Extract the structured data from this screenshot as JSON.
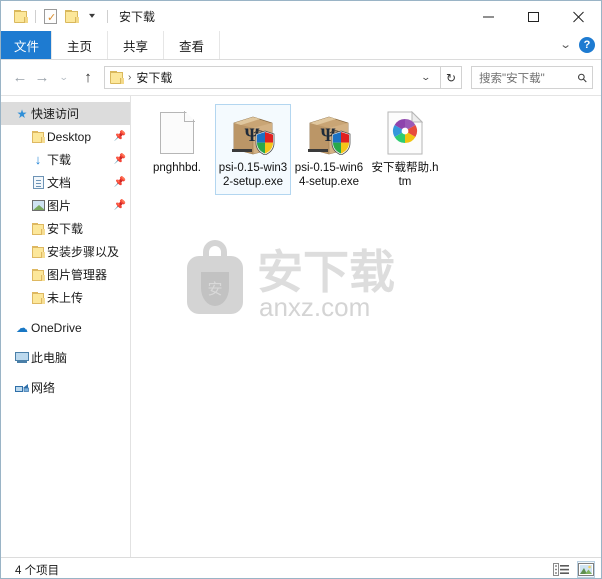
{
  "window": {
    "title": "安下载",
    "quick_access": [
      {
        "name": "folder-icon",
        "label": "文件夹"
      },
      {
        "name": "properties-icon",
        "label": "属性"
      },
      {
        "name": "new-folder-icon",
        "label": "新建文件夹"
      },
      {
        "name": "customize-dropdown-icon",
        "label": "自定义快速访问工具栏"
      }
    ],
    "controls": {
      "minimize": "最小化",
      "maximize": "最大化",
      "close": "关闭"
    }
  },
  "ribbon": {
    "tabs": [
      {
        "label": "文件",
        "selected": true
      },
      {
        "label": "主页",
        "selected": false
      },
      {
        "label": "共享",
        "selected": false
      },
      {
        "label": "查看",
        "selected": false
      }
    ],
    "collapse_label": "展开功能区",
    "help_label": "?",
    "accent_color": "#1e7bd1"
  },
  "address": {
    "back_label": "后退",
    "forward_label": "前进",
    "recent_label": "最近浏览的位置",
    "up_label": "上移一级",
    "breadcrumb": [
      "安下载"
    ],
    "breadcrumb_separator": "›",
    "dropdown_label": "∨",
    "refresh_label": "刷新"
  },
  "search": {
    "placeholder": "搜索\"安下载\"",
    "icon": "search-icon"
  },
  "sidebar": {
    "items": [
      {
        "label": "快速访问",
        "icon": "quick-access-star-icon",
        "level": 0,
        "selected": true,
        "pinned": false
      },
      {
        "label": "Desktop",
        "icon": "folder-icon",
        "level": 1,
        "selected": false,
        "pinned": true
      },
      {
        "label": "下载",
        "icon": "downloads-arrow-icon",
        "level": 1,
        "selected": false,
        "pinned": true
      },
      {
        "label": "文档",
        "icon": "documents-icon",
        "level": 1,
        "selected": false,
        "pinned": true
      },
      {
        "label": "图片",
        "icon": "pictures-icon",
        "level": 1,
        "selected": false,
        "pinned": true
      },
      {
        "label": "安下载",
        "icon": "folder-icon",
        "level": 1,
        "selected": false,
        "pinned": false
      },
      {
        "label": "安装步骤以及",
        "icon": "folder-icon",
        "level": 1,
        "selected": false,
        "pinned": false
      },
      {
        "label": "图片管理器",
        "icon": "folder-icon",
        "level": 1,
        "selected": false,
        "pinned": false
      },
      {
        "label": "未上传",
        "icon": "folder-icon",
        "level": 1,
        "selected": false,
        "pinned": false
      },
      {
        "label": "OneDrive",
        "icon": "onedrive-cloud-icon",
        "level": 0,
        "selected": false,
        "pinned": false
      },
      {
        "label": "此电脑",
        "icon": "this-pc-icon",
        "level": 0,
        "selected": false,
        "pinned": false
      },
      {
        "label": "网络",
        "icon": "network-icon",
        "level": 0,
        "selected": false,
        "pinned": false
      }
    ],
    "pin_glyph": "📌"
  },
  "files": [
    {
      "name": "pnghhbd.",
      "icon": "blank-file-icon",
      "selected": false
    },
    {
      "name": "psi-0.15-win32-setup.exe",
      "icon": "setup-package-icon",
      "selected": true
    },
    {
      "name": "psi-0.15-win64-setup.exe",
      "icon": "setup-package-icon",
      "selected": false
    },
    {
      "name": "安下载帮助.htm",
      "icon": "html-document-icon",
      "selected": false
    }
  ],
  "watermark": {
    "logo_char": "安",
    "brand": "安下载",
    "domain": "anxz.com",
    "color": "#d2d2d2"
  },
  "statusbar": {
    "item_count_text": "4 个项目",
    "view_details_label": "详细信息",
    "view_large_icons_label": "大图标"
  }
}
